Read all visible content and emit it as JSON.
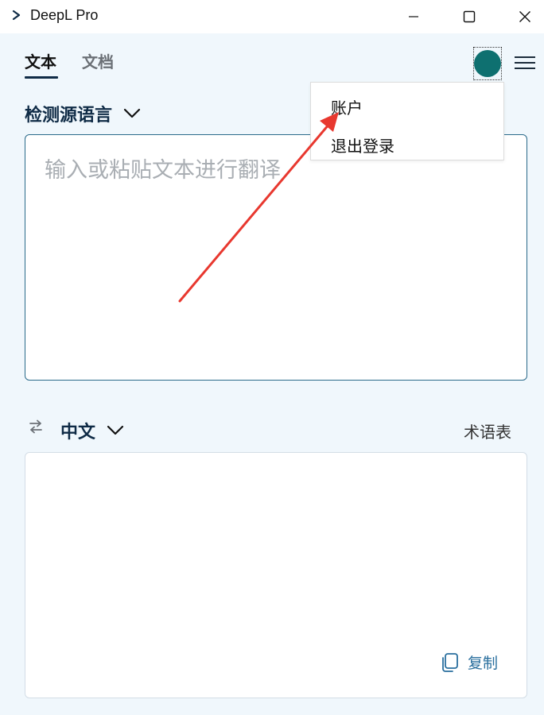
{
  "window": {
    "title": "DeepL Pro"
  },
  "tabs": [
    {
      "label": "文本",
      "active": true
    },
    {
      "label": "文档",
      "active": false
    }
  ],
  "source": {
    "language": "检测源语言",
    "placeholder": "输入或粘贴文本进行翻译"
  },
  "target": {
    "language": "中文",
    "glossary_label": "术语表",
    "copy_label": "复制"
  },
  "account_menu": {
    "items": [
      "账户",
      "退出登录"
    ]
  },
  "colors": {
    "background": "#f0f7fc",
    "avatar": "#0e7070",
    "accent_dark": "#0f2b46",
    "copy": "#2a6f9e",
    "annotation_arrow": "#e8382f"
  },
  "icons": {
    "app_logo": "deepl-chevron-icon",
    "minimize": "minimize-icon",
    "maximize": "maximize-icon",
    "close": "close-icon",
    "menu": "hamburger-menu-icon",
    "swap": "swap-arrows-icon",
    "dropdown": "chevron-down-icon",
    "copy": "copy-icon"
  }
}
